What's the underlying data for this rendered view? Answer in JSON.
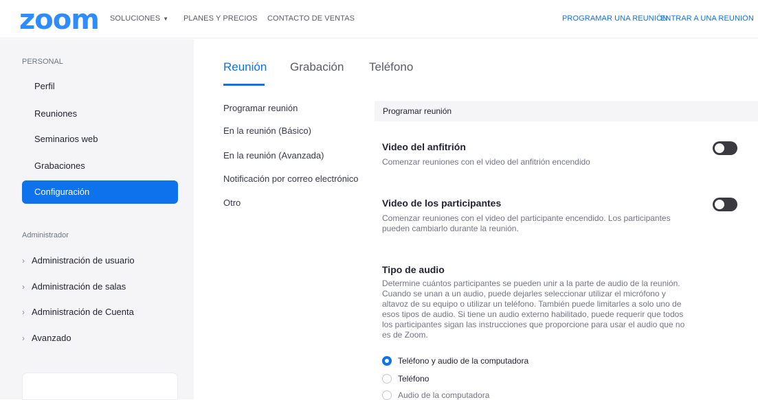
{
  "header": {
    "logo": "zoom",
    "nav": {
      "solutions": "SOLUCIONES",
      "plans": "PLANES Y PRECIOS",
      "contact": "CONTACTO DE VENTAS",
      "schedule": "PROGRAMAR UNA REUNIÓN",
      "join": "ENTRAR A UNA REUNIÓN"
    },
    "colors": {
      "brand": "#2d8cff",
      "accent": "#0e72ed"
    }
  },
  "sidebar": {
    "personal_label": "PERSONAL",
    "items": [
      "Perfil",
      "Reuniones",
      "Seminarios web",
      "Grabaciones",
      "Configuración"
    ],
    "admin_label": "Administrador",
    "admin_items": [
      "Administración de usuario",
      "Administración de salas",
      "Administración de Cuenta",
      "Avanzado"
    ]
  },
  "tabs": [
    "Reunión",
    "Grabación",
    "Teléfono"
  ],
  "subnav": [
    "Programar reunión",
    "En la reunión (Básico)",
    "En la reunión (Avanzada)",
    "Notificación por correo electrónico",
    "Otro"
  ],
  "content": {
    "section_header": "Programar reunión",
    "settings": [
      {
        "title": "Video del anfitrión",
        "desc": "Comenzar reuniones con el video del anfitrión encendido",
        "enabled": false
      },
      {
        "title": "Video de los participantes",
        "desc_lines": [
          "Comenzar reuniones con el video del participante encendido. Los participantes",
          "pueden cambiarlo durante la reunión."
        ],
        "enabled": false
      }
    ],
    "audio": {
      "title": "Tipo de audio",
      "desc_lines": [
        "Determine cuántos participantes se pueden unir a la parte de audio de la reunión.",
        "Cuando se unan a un audio, puede dejarles seleccionar utilizar el micrófono y",
        "altavoz de su equipo o utilizar un teléfono. También puede limitarles a solo uno de",
        "esos tipos de audio. Si tiene un audio externo habilitado, puede requerir que todos",
        "los participantes sigan las instrucciones que proporcione para usar el audio que no",
        "es de Zoom."
      ],
      "options": [
        "Teléfono y audio de la computadora",
        "Teléfono",
        "Audio de la computadora"
      ],
      "selected": "Teléfono y audio de la computadora"
    }
  }
}
